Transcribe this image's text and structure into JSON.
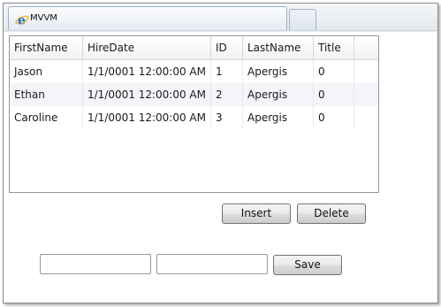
{
  "window": {
    "tab_title": "MVVM",
    "tab_icon": "internet-explorer-icon"
  },
  "grid": {
    "columns": [
      "FirstName",
      "HireDate",
      "ID",
      "LastName",
      "Title",
      ""
    ],
    "rows": [
      [
        "Jason",
        "1/1/0001 12:00:00 AM",
        "1",
        "Apergis",
        "0"
      ],
      [
        "Ethan",
        "1/1/0001 12:00:00 AM",
        "2",
        "Apergis",
        "0"
      ],
      [
        "Caroline",
        "1/1/0001 12:00:00 AM",
        "3",
        "Apergis",
        "0"
      ]
    ]
  },
  "actions": {
    "insert_label": "Insert",
    "delete_label": "Delete",
    "save_label": "Save"
  },
  "form": {
    "first_value": "",
    "last_value": ""
  },
  "colors": {
    "ie_blue": "#1e6fd0",
    "ie_ring": "#f0b323",
    "header_border": "#d5d8dc",
    "alt_row": "#f3f5f9"
  }
}
